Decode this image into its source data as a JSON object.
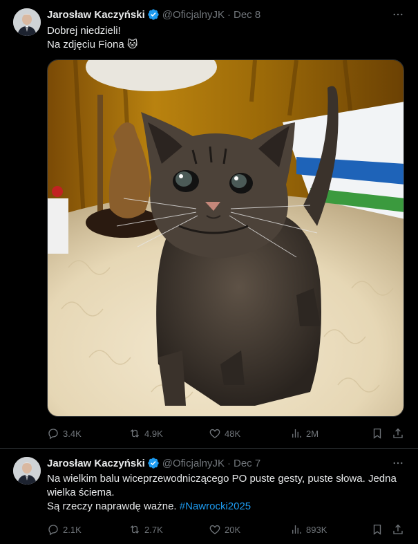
{
  "tweets": [
    {
      "author_name": "Jarosław Kaczyński",
      "handle": "@OficjalnyJK",
      "separator": "·",
      "date": "Dec 8",
      "text_lines": [
        "Dobrej niedzieli!",
        "Na zdjęciu Fiona 🐱"
      ],
      "stats": {
        "replies": "3.4K",
        "reposts": "4.9K",
        "likes": "48K",
        "views": "2M"
      }
    },
    {
      "author_name": "Jarosław Kaczyński",
      "handle": "@OficjalnyJK",
      "separator": "·",
      "date": "Dec 7",
      "text_lines": [
        "Na wielkim balu wiceprzewodniczącego PO puste gesty, puste słowa. Jedna",
        "wielka ściema.",
        "Są rzeczy naprawdę ważne. "
      ],
      "hashtag": "#Nawrocki2025",
      "stats": {
        "replies": "2.1K",
        "reposts": "2.7K",
        "likes": "20K",
        "views": "893K"
      }
    }
  ],
  "colors": {
    "background": "#000000",
    "text": "#e7e9ea",
    "muted": "#71767b",
    "accent": "#1d9bf0",
    "divider": "#2f3336"
  },
  "icons": [
    "verified-badge-icon",
    "more-icon",
    "reply-icon",
    "repost-icon",
    "like-icon",
    "views-icon",
    "bookmark-icon",
    "share-icon"
  ]
}
